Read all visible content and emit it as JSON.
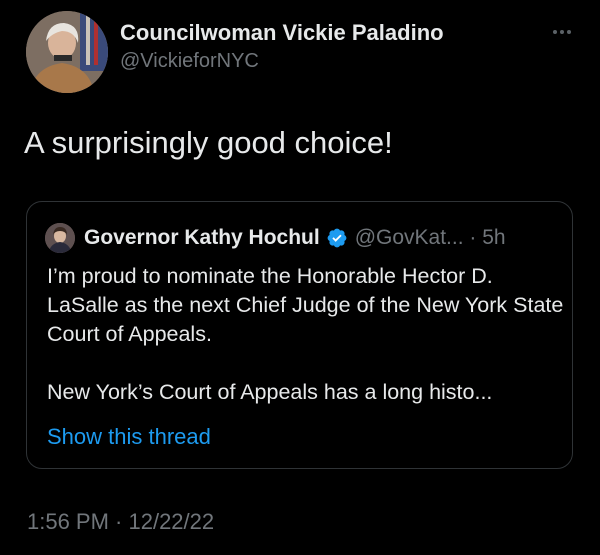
{
  "author": {
    "display_name": "Councilwoman Vickie Paladino",
    "handle": "@VickieforNYC",
    "avatar_icon": "avatar-photo",
    "more_icon": "more-options-icon"
  },
  "tweet": {
    "text": "A surprisingly good choice!"
  },
  "quoted_tweet": {
    "display_name": "Governor Kathy Hochul",
    "verified_icon": "verified-badge-icon",
    "handle_time": "@GovKat... · 5h",
    "paragraph_1": "I’m proud to nominate the Honorable Hector D. LaSalle as the next Chief Judge of the New York State Court of Appeals.",
    "paragraph_2": "New York’s Court of Appeals has a long histo...",
    "show_thread": "Show this thread"
  },
  "footer": {
    "timestamp": "1:56 PM · 12/22/22"
  },
  "colors": {
    "background": "#000000",
    "text": "#e7e9ea",
    "secondary": "#71767b",
    "link": "#1d9bf0",
    "border": "#2f3336"
  }
}
